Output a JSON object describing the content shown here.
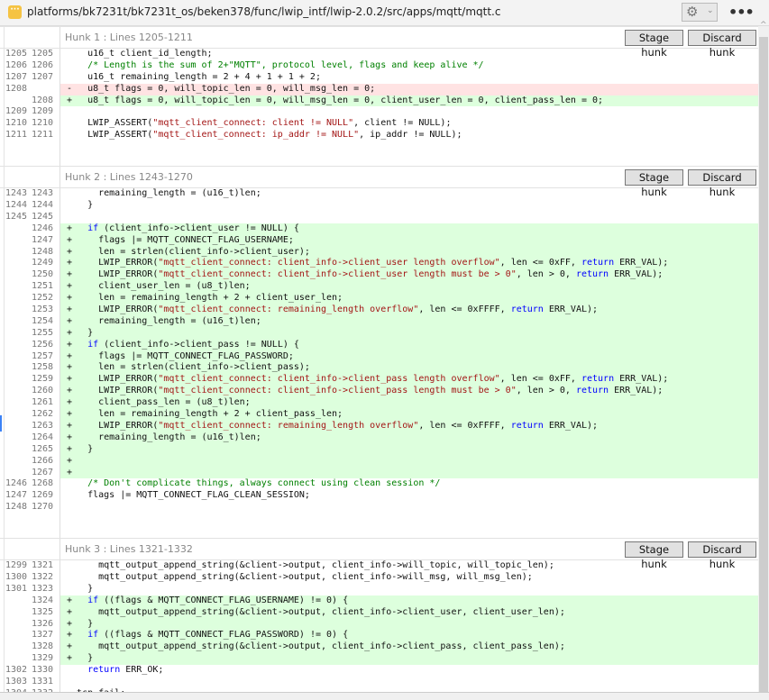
{
  "header": {
    "file_icon": "ellipsis-file-icon",
    "path": "platforms/bk7231t/bk7231t_os/beken378/func/lwip_intf/lwip-2.0.2/src/apps/mqtt/mqtt.c",
    "settings_icon": "gear-icon",
    "more_icon": "more-icon",
    "more_label": "•••"
  },
  "colors": {
    "added_bg": "#ddffdd",
    "deleted_bg": "#ffe3e3",
    "keyword": "#0000ff",
    "string": "#a31515",
    "comment": "#008000"
  },
  "hunks": [
    {
      "title": "Hunk 1 : Lines 1205-1211",
      "stage_label": "Stage hunk",
      "discard_label": "Discard hunk",
      "lines": [
        {
          "o": "1205",
          "n": "1205",
          "t": "ctx",
          "c": [
            [
              "    u16_t client_id_length;",
              ""
            ]
          ]
        },
        {
          "o": "1206",
          "n": "1206",
          "t": "ctx",
          "c": [
            [
              "    /* Length is the sum of 2+\"MQTT\", protocol level, flags and keep alive */",
              "m"
            ]
          ]
        },
        {
          "o": "1207",
          "n": "1207",
          "t": "ctx",
          "c": [
            [
              "    u16_t remaining_length = 2 + 4 + 1 + 1 + 2;",
              ""
            ]
          ]
        },
        {
          "o": "1208",
          "n": "",
          "t": "del",
          "c": [
            [
              "    u8_t flags = 0, will_topic_len = 0, will_msg_len = 0;",
              ""
            ]
          ]
        },
        {
          "o": "",
          "n": "1208",
          "t": "add",
          "c": [
            [
              "    u8_t flags = 0, will_topic_len = 0, will_msg_len = 0, client_user_len = 0, client_pass_len = 0;",
              ""
            ]
          ]
        },
        {
          "o": "1209",
          "n": "1209",
          "t": "ctx",
          "c": [
            [
              "",
              ""
            ]
          ]
        },
        {
          "o": "1210",
          "n": "1210",
          "t": "ctx",
          "c": [
            [
              "    LWIP_ASSERT(",
              ""
            ],
            [
              "\"mqtt_client_connect: client != NULL\"",
              "s"
            ],
            [
              ", client != NULL);",
              ""
            ]
          ]
        },
        {
          "o": "1211",
          "n": "1211",
          "t": "ctx",
          "c": [
            [
              "    LWIP_ASSERT(",
              ""
            ],
            [
              "\"mqtt_client_connect: ip_addr != NULL\"",
              "s"
            ],
            [
              ", ip_addr != NULL);",
              ""
            ]
          ]
        }
      ]
    },
    {
      "title": "Hunk 2 : Lines 1243-1270",
      "stage_label": "Stage hunk",
      "discard_label": "Discard hunk",
      "lines": [
        {
          "o": "1243",
          "n": "1243",
          "t": "ctx",
          "c": [
            [
              "      remaining_length = (u16_t)len;",
              ""
            ]
          ]
        },
        {
          "o": "1244",
          "n": "1244",
          "t": "ctx",
          "c": [
            [
              "    }",
              ""
            ]
          ]
        },
        {
          "o": "1245",
          "n": "1245",
          "t": "ctx",
          "c": [
            [
              "",
              ""
            ]
          ]
        },
        {
          "o": "",
          "n": "1246",
          "t": "add",
          "c": [
            [
              "    ",
              ""
            ],
            [
              "if",
              "k"
            ],
            [
              " (client_info->client_user != NULL) {",
              ""
            ]
          ]
        },
        {
          "o": "",
          "n": "1247",
          "t": "add",
          "c": [
            [
              "      flags |= MQTT_CONNECT_FLAG_USERNAME;",
              ""
            ]
          ]
        },
        {
          "o": "",
          "n": "1248",
          "t": "add",
          "c": [
            [
              "      len = strlen(client_info->client_user);",
              ""
            ]
          ]
        },
        {
          "o": "",
          "n": "1249",
          "t": "add",
          "c": [
            [
              "      LWIP_ERROR(",
              ""
            ],
            [
              "\"mqtt_client_connect: client_info->client_user length overflow\"",
              "s"
            ],
            [
              ", len <= 0xFF, ",
              ""
            ],
            [
              "return",
              "k"
            ],
            [
              " ERR_VAL);",
              ""
            ]
          ]
        },
        {
          "o": "",
          "n": "1250",
          "t": "add",
          "c": [
            [
              "      LWIP_ERROR(",
              ""
            ],
            [
              "\"mqtt_client_connect: client_info->client_user length must be > 0\"",
              "s"
            ],
            [
              ", len > 0, ",
              ""
            ],
            [
              "return",
              "k"
            ],
            [
              " ERR_VAL);",
              ""
            ]
          ]
        },
        {
          "o": "",
          "n": "1251",
          "t": "add",
          "c": [
            [
              "      client_user_len = (u8_t)len;",
              ""
            ]
          ]
        },
        {
          "o": "",
          "n": "1252",
          "t": "add",
          "c": [
            [
              "      len = remaining_length + 2 + client_user_len;",
              ""
            ]
          ]
        },
        {
          "o": "",
          "n": "1253",
          "t": "add",
          "c": [
            [
              "      LWIP_ERROR(",
              ""
            ],
            [
              "\"mqtt_client_connect: remaining_length overflow\"",
              "s"
            ],
            [
              ", len <= 0xFFFF, ",
              ""
            ],
            [
              "return",
              "k"
            ],
            [
              " ERR_VAL);",
              ""
            ]
          ]
        },
        {
          "o": "",
          "n": "1254",
          "t": "add",
          "c": [
            [
              "      remaining_length = (u16_t)len;",
              ""
            ]
          ]
        },
        {
          "o": "",
          "n": "1255",
          "t": "add",
          "c": [
            [
              "    }",
              ""
            ]
          ]
        },
        {
          "o": "",
          "n": "1256",
          "t": "add",
          "c": [
            [
              "    ",
              ""
            ],
            [
              "if",
              "k"
            ],
            [
              " (client_info->client_pass != NULL) {",
              ""
            ]
          ]
        },
        {
          "o": "",
          "n": "1257",
          "t": "add",
          "c": [
            [
              "      flags |= MQTT_CONNECT_FLAG_PASSWORD;",
              ""
            ]
          ]
        },
        {
          "o": "",
          "n": "1258",
          "t": "add",
          "c": [
            [
              "      len = strlen(client_info->client_pass);",
              ""
            ]
          ]
        },
        {
          "o": "",
          "n": "1259",
          "t": "add",
          "c": [
            [
              "      LWIP_ERROR(",
              ""
            ],
            [
              "\"mqtt_client_connect: client_info->client_pass length overflow\"",
              "s"
            ],
            [
              ", len <= 0xFF, ",
              ""
            ],
            [
              "return",
              "k"
            ],
            [
              " ERR_VAL);",
              ""
            ]
          ]
        },
        {
          "o": "",
          "n": "1260",
          "t": "add",
          "c": [
            [
              "      LWIP_ERROR(",
              ""
            ],
            [
              "\"mqtt_client_connect: client_info->client_pass length must be > 0\"",
              "s"
            ],
            [
              ", len > 0, ",
              ""
            ],
            [
              "return",
              "k"
            ],
            [
              " ERR_VAL);",
              ""
            ]
          ]
        },
        {
          "o": "",
          "n": "1261",
          "t": "add",
          "c": [
            [
              "      client_pass_len = (u8_t)len;",
              ""
            ]
          ]
        },
        {
          "o": "",
          "n": "1262",
          "t": "add",
          "c": [
            [
              "      len = remaining_length + 2 + client_pass_len;",
              ""
            ]
          ]
        },
        {
          "o": "",
          "n": "1263",
          "t": "add",
          "c": [
            [
              "      LWIP_ERROR(",
              ""
            ],
            [
              "\"mqtt_client_connect: remaining_length overflow\"",
              "s"
            ],
            [
              ", len <= 0xFFFF, ",
              ""
            ],
            [
              "return",
              "k"
            ],
            [
              " ERR_VAL);",
              ""
            ]
          ]
        },
        {
          "o": "",
          "n": "1264",
          "t": "add",
          "c": [
            [
              "      remaining_length = (u16_t)len;",
              ""
            ]
          ]
        },
        {
          "o": "",
          "n": "1265",
          "t": "add",
          "c": [
            [
              "    }",
              ""
            ]
          ]
        },
        {
          "o": "",
          "n": "1266",
          "t": "add",
          "c": [
            [
              "",
              ""
            ]
          ]
        },
        {
          "o": "",
          "n": "1267",
          "t": "add",
          "c": [
            [
              "",
              ""
            ]
          ]
        },
        {
          "o": "1246",
          "n": "1268",
          "t": "ctx",
          "c": [
            [
              "    /* Don't complicate things, always connect using clean session */",
              "m"
            ]
          ]
        },
        {
          "o": "1247",
          "n": "1269",
          "t": "ctx",
          "c": [
            [
              "    flags |= MQTT_CONNECT_FLAG_CLEAN_SESSION;",
              ""
            ]
          ]
        },
        {
          "o": "1248",
          "n": "1270",
          "t": "ctx",
          "c": [
            [
              "",
              ""
            ]
          ]
        }
      ]
    },
    {
      "title": "Hunk 3 : Lines 1321-1332",
      "stage_label": "Stage hunk",
      "discard_label": "Discard hunk",
      "lines": [
        {
          "o": "1299",
          "n": "1321",
          "t": "ctx",
          "c": [
            [
              "      mqtt_output_append_string(&client->output, client_info->will_topic, will_topic_len);",
              ""
            ]
          ]
        },
        {
          "o": "1300",
          "n": "1322",
          "t": "ctx",
          "c": [
            [
              "      mqtt_output_append_string(&client->output, client_info->will_msg, will_msg_len);",
              ""
            ]
          ]
        },
        {
          "o": "1301",
          "n": "1323",
          "t": "ctx",
          "c": [
            [
              "    }",
              ""
            ]
          ]
        },
        {
          "o": "",
          "n": "1324",
          "t": "add",
          "c": [
            [
              "    ",
              ""
            ],
            [
              "if",
              "k"
            ],
            [
              " ((flags & MQTT_CONNECT_FLAG_USERNAME) != 0) {",
              ""
            ]
          ]
        },
        {
          "o": "",
          "n": "1325",
          "t": "add",
          "c": [
            [
              "      mqtt_output_append_string(&client->output, client_info->client_user, client_user_len);",
              ""
            ]
          ]
        },
        {
          "o": "",
          "n": "1326",
          "t": "add",
          "c": [
            [
              "    }",
              ""
            ]
          ]
        },
        {
          "o": "",
          "n": "1327",
          "t": "add",
          "c": [
            [
              "    ",
              ""
            ],
            [
              "if",
              "k"
            ],
            [
              " ((flags & MQTT_CONNECT_FLAG_PASSWORD) != 0) {",
              ""
            ]
          ]
        },
        {
          "o": "",
          "n": "1328",
          "t": "add",
          "c": [
            [
              "      mqtt_output_append_string(&client->output, client_info->client_pass, client_pass_len);",
              ""
            ]
          ]
        },
        {
          "o": "",
          "n": "1329",
          "t": "add",
          "c": [
            [
              "    }",
              ""
            ]
          ]
        },
        {
          "o": "1302",
          "n": "1330",
          "t": "ctx",
          "c": [
            [
              "    ",
              ""
            ],
            [
              "return",
              "k"
            ],
            [
              " ERR_OK;",
              ""
            ]
          ]
        },
        {
          "o": "1303",
          "n": "1331",
          "t": "ctx",
          "c": [
            [
              "",
              ""
            ]
          ]
        },
        {
          "o": "1304",
          "n": "1332",
          "t": "ctx",
          "c": [
            [
              "  tcp_fail:",
              ""
            ]
          ]
        }
      ]
    }
  ]
}
